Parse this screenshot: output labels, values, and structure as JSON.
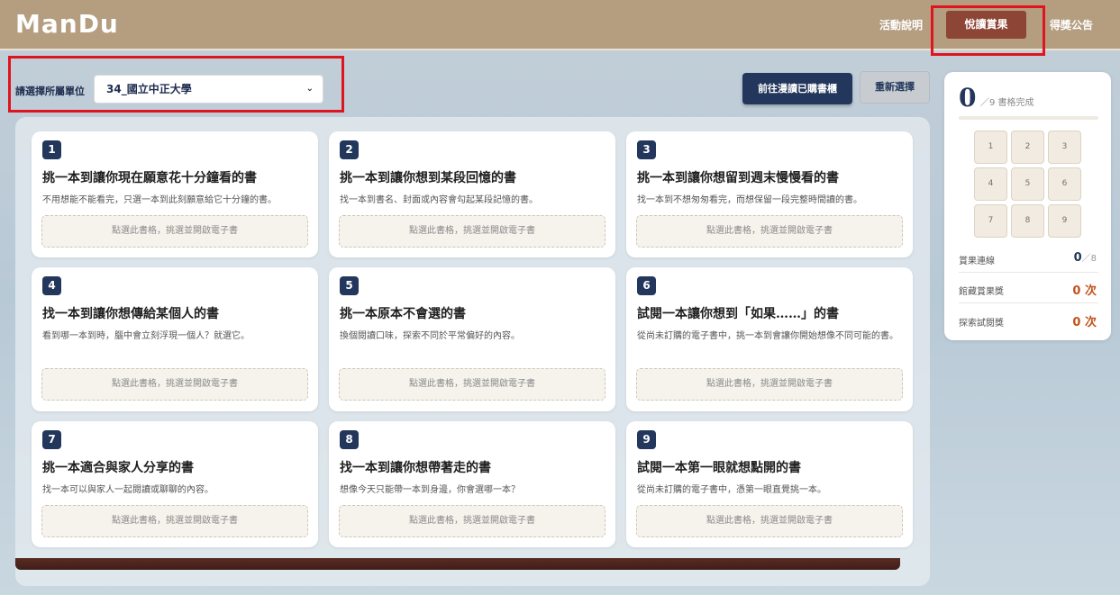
{
  "header": {
    "logo": "ManDu",
    "nav": [
      {
        "label": "活動說明"
      },
      {
        "label": "悅讀賞果"
      },
      {
        "label": "得獎公告"
      }
    ]
  },
  "unit": {
    "label": "請選擇所屬單位",
    "selected": "34_國立中正大學"
  },
  "actions": {
    "go_shelf": "前往漫讀已購書櫃",
    "reset": "重新選擇"
  },
  "pick_label": "點選此書格，挑選並開啟電子書",
  "cards": [
    {
      "num": "1",
      "title": "挑一本到讓你現在願意花十分鐘看的書",
      "desc": "不用想能不能看完，只選一本到此刻願意給它十分鐘的書。"
    },
    {
      "num": "2",
      "title": "挑一本到讓你想到某段回憶的書",
      "desc": "找一本到書名、封面或內容會勾起某段記憶的書。"
    },
    {
      "num": "3",
      "title": "挑一本到讓你想留到週末慢慢看的書",
      "desc": "找一本到不想匆匆看完，而想保留一段完整時間讀的書。"
    },
    {
      "num": "4",
      "title": "找一本到讓你想傳給某個人的書",
      "desc": "看到哪一本到時，腦中會立刻浮現一個人？就選它。"
    },
    {
      "num": "5",
      "title": "挑一本原本不會選的書",
      "desc": "換個閱讀口味，探索不同於平常偏好的內容。"
    },
    {
      "num": "6",
      "title": "試閱一本讓你想到「如果……」的書",
      "desc": "從尚未訂購的電子書中，挑一本到會讓你開始想像不同可能的書。"
    },
    {
      "num": "7",
      "title": "挑一本適合與家人分享的書",
      "desc": "找一本可以與家人一起閱讀或聊聊的內容。"
    },
    {
      "num": "8",
      "title": "找一本到讓你想帶著走的書",
      "desc": "想像今天只能帶一本到身邊，你會選哪一本？"
    },
    {
      "num": "9",
      "title": "試閱一本第一眼就想點開的書",
      "desc": "從尚未訂購的電子書中，憑第一眼直覺挑一本。"
    }
  ],
  "progress": {
    "done": "0",
    "total_label": "／9 書格完成",
    "fraction": 0,
    "grid": [
      "1",
      "2",
      "3",
      "4",
      "5",
      "6",
      "7",
      "8",
      "9"
    ]
  },
  "stats": [
    {
      "label": "賞果連線",
      "value": "0",
      "suffix": "／8",
      "color": "#23375c"
    },
    {
      "label": "館藏賞果獎",
      "value": "0 次",
      "suffix": "",
      "color": "#c0541d"
    },
    {
      "label": "探索試閱獎",
      "value": "0 次",
      "suffix": "",
      "color": "#c0541d"
    }
  ]
}
